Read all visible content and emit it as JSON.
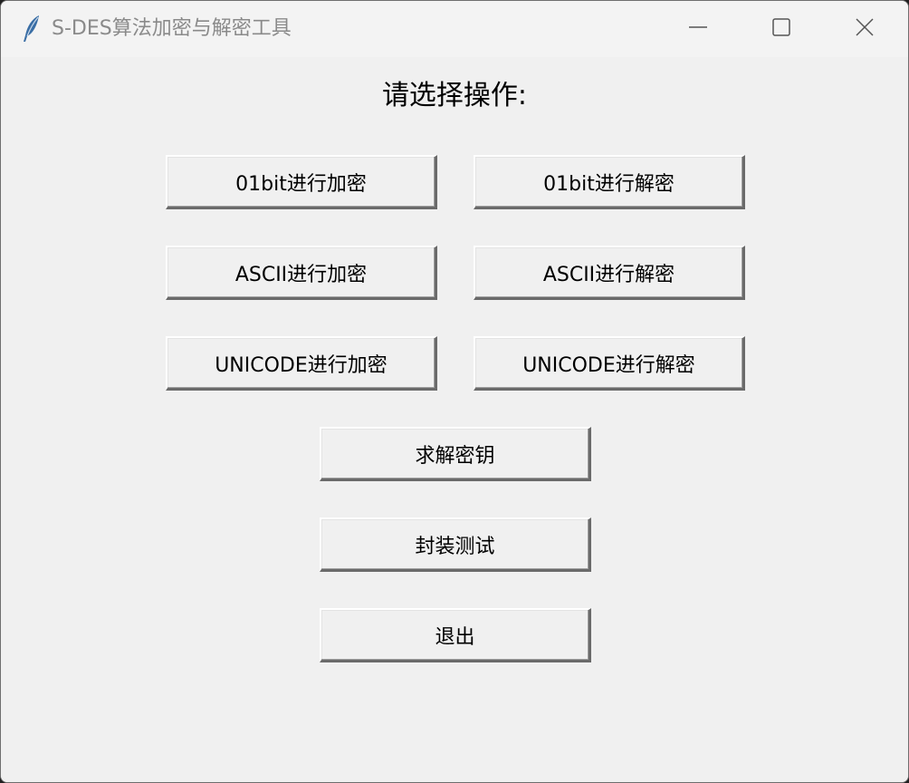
{
  "window": {
    "title": "S-DES算法加密与解密工具",
    "icons": {
      "app": "feather-icon",
      "minimize": "minimize-icon",
      "maximize": "maximize-icon",
      "close": "close-icon"
    }
  },
  "main": {
    "prompt": "请选择操作:",
    "buttons": {
      "bit_encrypt": "01bit进行加密",
      "bit_decrypt": "01bit进行解密",
      "ascii_encrypt": "ASCII进行加密",
      "ascii_decrypt": "ASCII进行解密",
      "unicode_encrypt": "UNICODE进行加密",
      "unicode_decrypt": "UNICODE进行解密",
      "solve_key": "求解密钥",
      "package_test": "封装测试",
      "exit": "退出"
    }
  }
}
